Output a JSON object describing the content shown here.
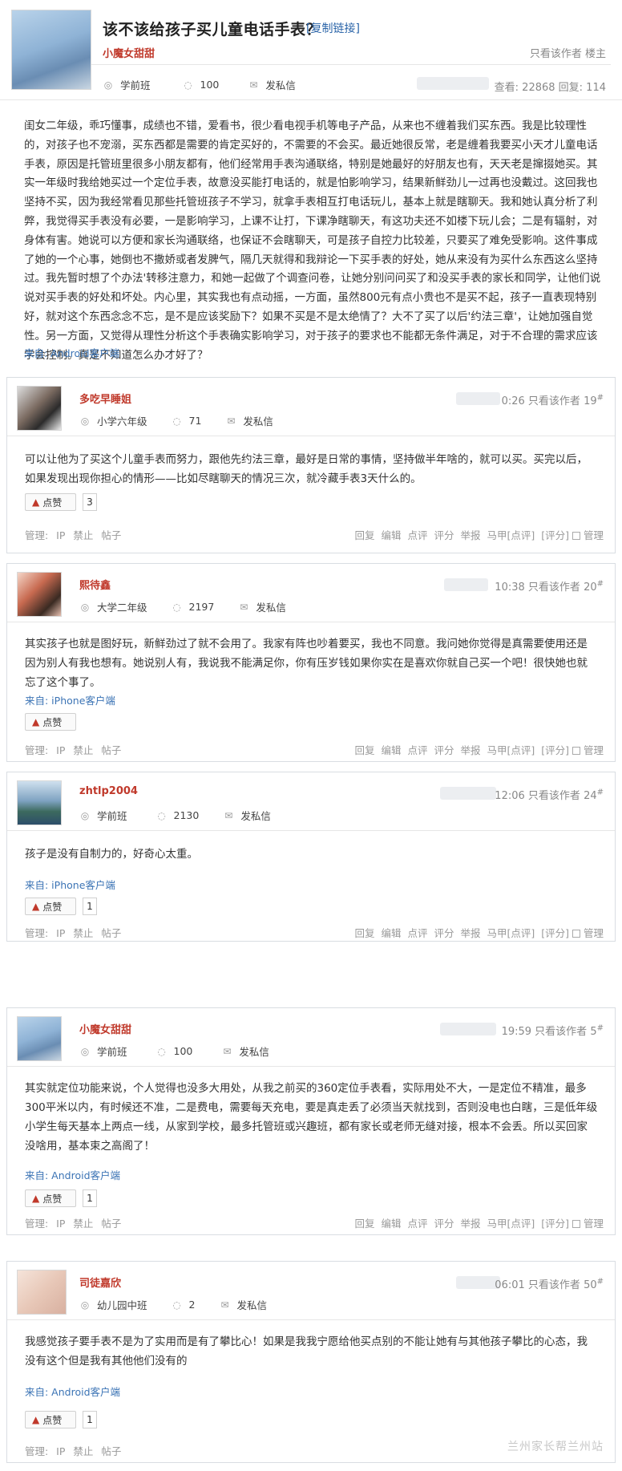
{
  "op": {
    "title": "该不该给孩子买儿童电话手表？",
    "copy_link": "[复制链接]",
    "username": "小魔女甜甜",
    "right": "只看该作者  楼主",
    "grade": "学前班",
    "points": "100",
    "pm": "发私信",
    "stats": "查看: 22868  回复: 114",
    "body": "闺女二年级，乖巧懂事，成绩也不错，爱看书，很少看电视手机等电子产品，从来也不缠着我们买东西。我是比较理性的，对孩子也不宠溺，买东西都是需要的肯定买好的，不需要的不会买。最近她很反常，老是缠着我要买小天才儿童电话手表，原因是托管班里很多小朋友都有，他们经常用手表沟通联络，特别是她最好的好朋友也有，天天老是撺掇她买。其实一年级时我给她买过一个定位手表，故意没买能打电话的，就是怕影响学习，结果新鲜劲儿一过再也没戴过。这回我也坚持不买，因为我经常看见那些托管班孩子不学习，就拿手表相互打电话玩儿，基本上就是瞎聊天。我和她认真分析了利弊，我觉得买手表没有必要，一是影响学习，上课不让打，下课净瞎聊天，有这功夫还不如楼下玩儿会；二是有辐射，对身体有害。她说可以方便和家长沟通联络，也保证不会瞎聊天，可是孩子自控力比较差，只要买了难免受影响。这件事成了她的一个心事，她倒也不撒娇或者发脾气，隔几天就得和我辩论一下买手表的好处，她从来没有为买什么东西这么坚持过。我先暂时想了个办法'转移注意力，和她一起做了个调查问卷，让她分别问问买了和没买手表的家长和同学，让他们说说对买手表的好处和坏处。内心里，其实我也有点动摇，一方面，虽然800元有点小贵也不是买不起，孩子一直表现特别好，就对这个东西念念不忘，是不是应该奖励下？如果不买是不是太绝情了？大不了买了以后'约法三章'，让她加强自觉性。另一方面，又觉得从理性分析这个手表确实影响学习，对于孩子的要求也不能都无条件满足，对于不合理的需求应该学会控制。真是不知道怎么办才好了？",
    "source": "来自: Android客户端"
  },
  "replies": [
    {
      "username": "多吃早睡姐",
      "grade": "小学六年级",
      "points": "71",
      "pm": "发私信",
      "time": "0:26",
      "only": "只看该作者",
      "floor": "19",
      "text": "可以让他为了买这个儿童手表而努力，跟他先约法三章，最好是日常的事情，坚持做半年啥的，就可以买。买完以后，如果发现出现你担心的情形——比如尽瞎聊天的情况三次，就冷藏手表3天什么的。",
      "source": "",
      "like": "点赞",
      "likes": "3"
    },
    {
      "username": "熙待鑫",
      "grade": "大学二年级",
      "points": "2197",
      "pm": "发私信",
      "time": "10:38",
      "only": "只看该作者",
      "floor": "20",
      "text": "其实孩子也就是图好玩，新鲜劲过了就不会用了。我家有阵也吵着要买，我也不同意。我问她你觉得是真需要使用还是因为别人有我也想有。她说别人有，我说我不能满足你，你有压岁钱如果你实在是喜欢你就自己买一个吧！很快她也就忘了这个事了。",
      "source": "来自: iPhone客户端",
      "like": "点赞",
      "likes": ""
    },
    {
      "username": "zhtlp2004",
      "grade": "学前班",
      "points": "2130",
      "pm": "发私信",
      "time": "12:06",
      "only": "只看该作者",
      "floor": "24",
      "text": "孩子是没有自制力的，好奇心太重。",
      "source": "来自: iPhone客户端",
      "like": "点赞",
      "likes": "1"
    },
    {
      "username": "小魔女甜甜",
      "grade": "学前班",
      "points": "100",
      "pm": "发私信",
      "time": "19:59",
      "only": "只看该作者",
      "floor": "5",
      "text": "其实就定位功能来说，个人觉得也没多大用处，从我之前买的360定位手表看，实际用处不大，一是定位不精准，最多300平米以内，有时候还不准，二是费电，需要每天充电，要是真走丢了必须当天就找到，否则没电也白瞎，三是低年级小学生每天基本上两点一线，从家到学校，最多托管班或兴趣班，都有家长或老师无缝对接，根本不会丢。所以买回家没啥用，基本束之高阁了！",
      "source": "来自: Android客户端",
      "like": "点赞",
      "likes": "1"
    },
    {
      "username": "司徒嘉欣",
      "grade": "幼儿园中班",
      "points": "2",
      "pm": "发私信",
      "time": "06:01",
      "only": "只看该作者",
      "floor": "50",
      "text": "我感觉孩子要手表不是为了实用而是有了攀比心！如果是我我宁愿给他买点别的不能让她有与其他孩子攀比的心态，我没有这个但是我有其他他们没有的",
      "source": "来自: Android客户端",
      "like": "点赞",
      "likes": "1"
    }
  ],
  "mgmt": "管理: IP 禁止 帖子",
  "actions": [
    "回复",
    "编辑",
    "点评",
    "评分",
    "举报",
    "马甲[点评]",
    "[评分]",
    "管理"
  ],
  "watermark": "兰州家长帮兰州站",
  "colors": {
    "username": "#c0392b",
    "link": "#3c74b5",
    "border": "#d9dde2"
  },
  "icons": [
    "grade-icon",
    "points-icon",
    "message-icon",
    "thumbs-up-icon"
  ]
}
